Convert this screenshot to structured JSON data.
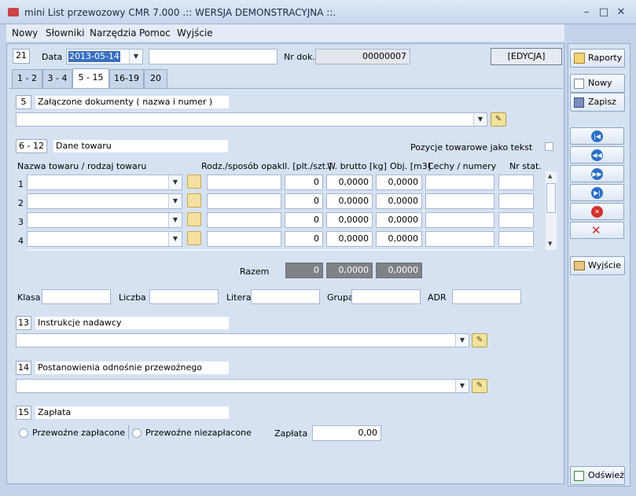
{
  "window": {
    "title": "mini List przewozowy CMR 7.000 .:: WERSJA DEMONSTRACYJNA ::.",
    "minimize": "–",
    "maximize": "□",
    "close": "✕"
  },
  "menu": [
    "Nowy",
    "Słowniki",
    "Narzędzia",
    "Pomoc",
    "Wyjście"
  ],
  "header": {
    "field_num": "21",
    "date_label": "Data",
    "date_value": "2013-05-14",
    "extra_value": "",
    "doc_label": "Nr dok.",
    "doc_value": "00000007",
    "mode": "[EDYCJA]"
  },
  "tabs": [
    "1 - 2",
    "3 - 4",
    "5 - 15",
    "16-19",
    "20"
  ],
  "sec5": {
    "num": "5",
    "title": "Załączone dokumenty ( nazwa i numer )",
    "value": ""
  },
  "sec6": {
    "num": "6 - 12",
    "title": "Dane towaru",
    "toggle_label": "Pozycje towarowe jako tekst"
  },
  "goods_headers": [
    "Nazwa towaru / rodzaj towaru",
    "Rodz./sposób opak.",
    "Il. [plt./szt.]",
    "W. brutto [kg]",
    "Obj. [m3]",
    "Cechy / numery",
    "Nr stat."
  ],
  "goods_rows": [
    {
      "n": "1",
      "qty": "0",
      "weight": "0,0000",
      "vol": "0,0000"
    },
    {
      "n": "2",
      "qty": "0",
      "weight": "0,0000",
      "vol": "0,0000"
    },
    {
      "n": "3",
      "qty": "0",
      "weight": "0,0000",
      "vol": "0,0000"
    },
    {
      "n": "4",
      "qty": "0",
      "weight": "0,0000",
      "vol": "0,0000"
    }
  ],
  "totals": {
    "label": "Razem",
    "qty": "0",
    "weight": "0,0000",
    "vol": "0,0000"
  },
  "adr": {
    "klasa": "Klasa",
    "liczba": "Liczba",
    "litera": "Litera",
    "grupa": "Grupa",
    "adr": "ADR"
  },
  "sec13": {
    "num": "13",
    "title": "Instrukcje nadawcy"
  },
  "sec14": {
    "num": "14",
    "title": "Postanowienia odnośnie przewoźnego"
  },
  "sec15": {
    "num": "15",
    "title": "Zapłata",
    "paid": "Przewoźne zapłacone",
    "unpaid": "Przewoźne niezapłacone",
    "amount_label": "Zapłata",
    "amount": "0,00"
  },
  "side": {
    "reports": "Raporty",
    "new": "Nowy",
    "save": "Zapisz",
    "exit": "Wyjście",
    "refresh": "Odśwież"
  }
}
